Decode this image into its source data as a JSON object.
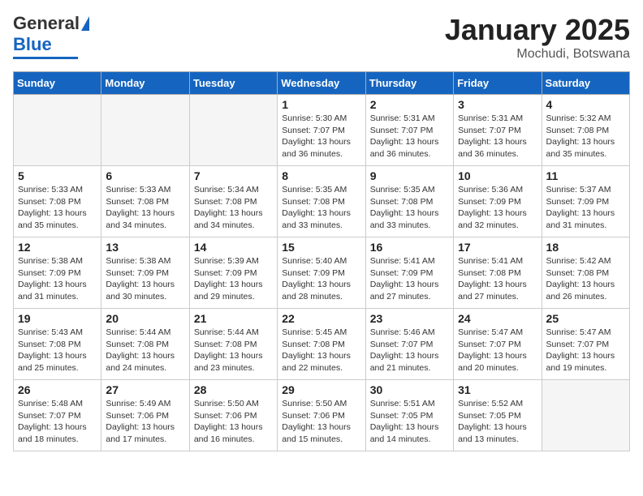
{
  "header": {
    "logo_general": "General",
    "logo_blue": "Blue",
    "month": "January 2025",
    "location": "Mochudi, Botswana"
  },
  "weekdays": [
    "Sunday",
    "Monday",
    "Tuesday",
    "Wednesday",
    "Thursday",
    "Friday",
    "Saturday"
  ],
  "weeks": [
    [
      {
        "day": "",
        "sunrise": "",
        "sunset": "",
        "daylight": ""
      },
      {
        "day": "",
        "sunrise": "",
        "sunset": "",
        "daylight": ""
      },
      {
        "day": "",
        "sunrise": "",
        "sunset": "",
        "daylight": ""
      },
      {
        "day": "1",
        "sunrise": "Sunrise: 5:30 AM",
        "sunset": "Sunset: 7:07 PM",
        "daylight": "Daylight: 13 hours and 36 minutes."
      },
      {
        "day": "2",
        "sunrise": "Sunrise: 5:31 AM",
        "sunset": "Sunset: 7:07 PM",
        "daylight": "Daylight: 13 hours and 36 minutes."
      },
      {
        "day": "3",
        "sunrise": "Sunrise: 5:31 AM",
        "sunset": "Sunset: 7:07 PM",
        "daylight": "Daylight: 13 hours and 36 minutes."
      },
      {
        "day": "4",
        "sunrise": "Sunrise: 5:32 AM",
        "sunset": "Sunset: 7:08 PM",
        "daylight": "Daylight: 13 hours and 35 minutes."
      }
    ],
    [
      {
        "day": "5",
        "sunrise": "Sunrise: 5:33 AM",
        "sunset": "Sunset: 7:08 PM",
        "daylight": "Daylight: 13 hours and 35 minutes."
      },
      {
        "day": "6",
        "sunrise": "Sunrise: 5:33 AM",
        "sunset": "Sunset: 7:08 PM",
        "daylight": "Daylight: 13 hours and 34 minutes."
      },
      {
        "day": "7",
        "sunrise": "Sunrise: 5:34 AM",
        "sunset": "Sunset: 7:08 PM",
        "daylight": "Daylight: 13 hours and 34 minutes."
      },
      {
        "day": "8",
        "sunrise": "Sunrise: 5:35 AM",
        "sunset": "Sunset: 7:08 PM",
        "daylight": "Daylight: 13 hours and 33 minutes."
      },
      {
        "day": "9",
        "sunrise": "Sunrise: 5:35 AM",
        "sunset": "Sunset: 7:08 PM",
        "daylight": "Daylight: 13 hours and 33 minutes."
      },
      {
        "day": "10",
        "sunrise": "Sunrise: 5:36 AM",
        "sunset": "Sunset: 7:09 PM",
        "daylight": "Daylight: 13 hours and 32 minutes."
      },
      {
        "day": "11",
        "sunrise": "Sunrise: 5:37 AM",
        "sunset": "Sunset: 7:09 PM",
        "daylight": "Daylight: 13 hours and 31 minutes."
      }
    ],
    [
      {
        "day": "12",
        "sunrise": "Sunrise: 5:38 AM",
        "sunset": "Sunset: 7:09 PM",
        "daylight": "Daylight: 13 hours and 31 minutes."
      },
      {
        "day": "13",
        "sunrise": "Sunrise: 5:38 AM",
        "sunset": "Sunset: 7:09 PM",
        "daylight": "Daylight: 13 hours and 30 minutes."
      },
      {
        "day": "14",
        "sunrise": "Sunrise: 5:39 AM",
        "sunset": "Sunset: 7:09 PM",
        "daylight": "Daylight: 13 hours and 29 minutes."
      },
      {
        "day": "15",
        "sunrise": "Sunrise: 5:40 AM",
        "sunset": "Sunset: 7:09 PM",
        "daylight": "Daylight: 13 hours and 28 minutes."
      },
      {
        "day": "16",
        "sunrise": "Sunrise: 5:41 AM",
        "sunset": "Sunset: 7:09 PM",
        "daylight": "Daylight: 13 hours and 27 minutes."
      },
      {
        "day": "17",
        "sunrise": "Sunrise: 5:41 AM",
        "sunset": "Sunset: 7:08 PM",
        "daylight": "Daylight: 13 hours and 27 minutes."
      },
      {
        "day": "18",
        "sunrise": "Sunrise: 5:42 AM",
        "sunset": "Sunset: 7:08 PM",
        "daylight": "Daylight: 13 hours and 26 minutes."
      }
    ],
    [
      {
        "day": "19",
        "sunrise": "Sunrise: 5:43 AM",
        "sunset": "Sunset: 7:08 PM",
        "daylight": "Daylight: 13 hours and 25 minutes."
      },
      {
        "day": "20",
        "sunrise": "Sunrise: 5:44 AM",
        "sunset": "Sunset: 7:08 PM",
        "daylight": "Daylight: 13 hours and 24 minutes."
      },
      {
        "day": "21",
        "sunrise": "Sunrise: 5:44 AM",
        "sunset": "Sunset: 7:08 PM",
        "daylight": "Daylight: 13 hours and 23 minutes."
      },
      {
        "day": "22",
        "sunrise": "Sunrise: 5:45 AM",
        "sunset": "Sunset: 7:08 PM",
        "daylight": "Daylight: 13 hours and 22 minutes."
      },
      {
        "day": "23",
        "sunrise": "Sunrise: 5:46 AM",
        "sunset": "Sunset: 7:07 PM",
        "daylight": "Daylight: 13 hours and 21 minutes."
      },
      {
        "day": "24",
        "sunrise": "Sunrise: 5:47 AM",
        "sunset": "Sunset: 7:07 PM",
        "daylight": "Daylight: 13 hours and 20 minutes."
      },
      {
        "day": "25",
        "sunrise": "Sunrise: 5:47 AM",
        "sunset": "Sunset: 7:07 PM",
        "daylight": "Daylight: 13 hours and 19 minutes."
      }
    ],
    [
      {
        "day": "26",
        "sunrise": "Sunrise: 5:48 AM",
        "sunset": "Sunset: 7:07 PM",
        "daylight": "Daylight: 13 hours and 18 minutes."
      },
      {
        "day": "27",
        "sunrise": "Sunrise: 5:49 AM",
        "sunset": "Sunset: 7:06 PM",
        "daylight": "Daylight: 13 hours and 17 minutes."
      },
      {
        "day": "28",
        "sunrise": "Sunrise: 5:50 AM",
        "sunset": "Sunset: 7:06 PM",
        "daylight": "Daylight: 13 hours and 16 minutes."
      },
      {
        "day": "29",
        "sunrise": "Sunrise: 5:50 AM",
        "sunset": "Sunset: 7:06 PM",
        "daylight": "Daylight: 13 hours and 15 minutes."
      },
      {
        "day": "30",
        "sunrise": "Sunrise: 5:51 AM",
        "sunset": "Sunset: 7:05 PM",
        "daylight": "Daylight: 13 hours and 14 minutes."
      },
      {
        "day": "31",
        "sunrise": "Sunrise: 5:52 AM",
        "sunset": "Sunset: 7:05 PM",
        "daylight": "Daylight: 13 hours and 13 minutes."
      },
      {
        "day": "",
        "sunrise": "",
        "sunset": "",
        "daylight": ""
      }
    ]
  ]
}
